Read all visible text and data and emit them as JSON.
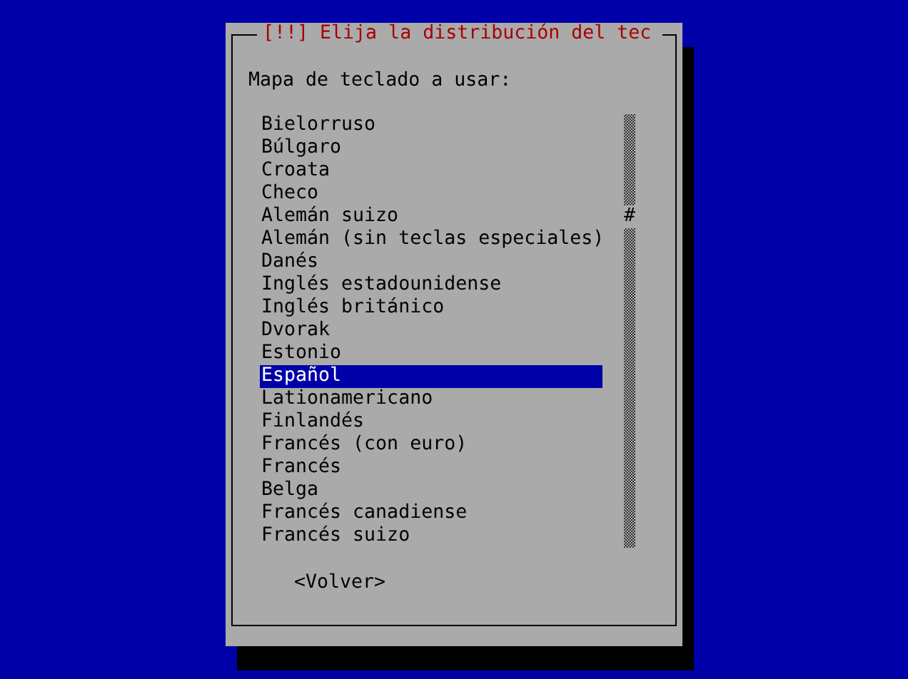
{
  "dialog": {
    "title": "[!!] Elija la distribución del tec",
    "prompt": "Mapa de teclado a usar:",
    "items": [
      {
        "label": "Bielorruso",
        "selected": false
      },
      {
        "label": "Búlgaro",
        "selected": false
      },
      {
        "label": "Croata",
        "selected": false
      },
      {
        "label": "Checo",
        "selected": false
      },
      {
        "label": "Alemán suizo",
        "selected": false
      },
      {
        "label": "Alemán (sin teclas especiales)",
        "selected": false
      },
      {
        "label": "Danés",
        "selected": false
      },
      {
        "label": "Inglés estadounidense",
        "selected": false
      },
      {
        "label": "Inglés británico",
        "selected": false
      },
      {
        "label": "Dvorak",
        "selected": false
      },
      {
        "label": "Estonio",
        "selected": false
      },
      {
        "label": "Español",
        "selected": true
      },
      {
        "label": "Lationamericano",
        "selected": false
      },
      {
        "label": "Finlandés",
        "selected": false
      },
      {
        "label": "Francés (con euro)",
        "selected": false
      },
      {
        "label": "Francés",
        "selected": false
      },
      {
        "label": "Belga",
        "selected": false
      },
      {
        "label": "Francés canadiense",
        "selected": false
      },
      {
        "label": "Francés suizo",
        "selected": false
      }
    ],
    "scrollbar_thumb": "#",
    "buttons": [
      "<Volver>"
    ]
  }
}
